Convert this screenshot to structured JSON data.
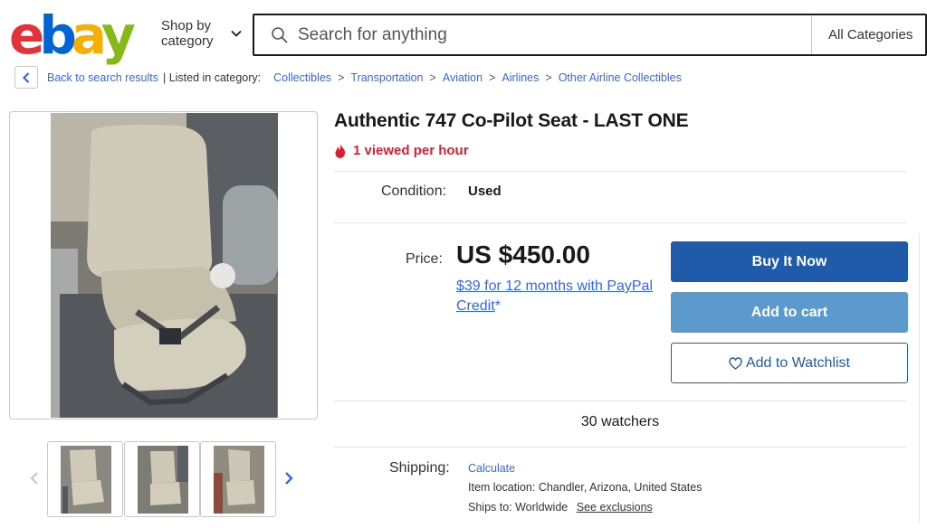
{
  "header": {
    "logo": [
      "e",
      "b",
      "a",
      "y"
    ],
    "shop_by_line1": "Shop by",
    "shop_by_line2": "category",
    "search_placeholder": "Search for anything",
    "category_select": "All Categories"
  },
  "breadcrumb": {
    "back": "Back to search results",
    "listed": "| Listed in category:",
    "items": [
      "Collectibles",
      "Transportation",
      "Aviation",
      "Airlines",
      "Other Airline Collectibles"
    ],
    "separator": ">"
  },
  "listing": {
    "title": "Authentic 747 Co-Pilot Seat - LAST ONE",
    "viewed": "1 viewed per hour",
    "condition_label": "Condition:",
    "condition_value": "Used",
    "price_label": "Price:",
    "price": "US $450.00",
    "credit_link": "$39 for 12 months with PayPal Credit",
    "credit_suffix": "*",
    "buy_now": "Buy It Now",
    "add_to_cart": "Add to cart",
    "watchlist": "Add to Watchlist",
    "watchers": "30 watchers",
    "shipping_label": "Shipping:",
    "shipping_calc": "Calculate",
    "location": "Item location:  Chandler, Arizona, United States",
    "ships_to": "Ships to:  Worldwide",
    "see_exclusions": "See exclusions"
  },
  "icons": {
    "logo_colors": [
      "#e53238",
      "#0064d2",
      "#f5af02",
      "#86b817"
    ],
    "accent": "#3665f3",
    "buy_color": "#1f5ba8",
    "cart_color": "#5c9ace",
    "alert_color": "#dd1e31"
  }
}
